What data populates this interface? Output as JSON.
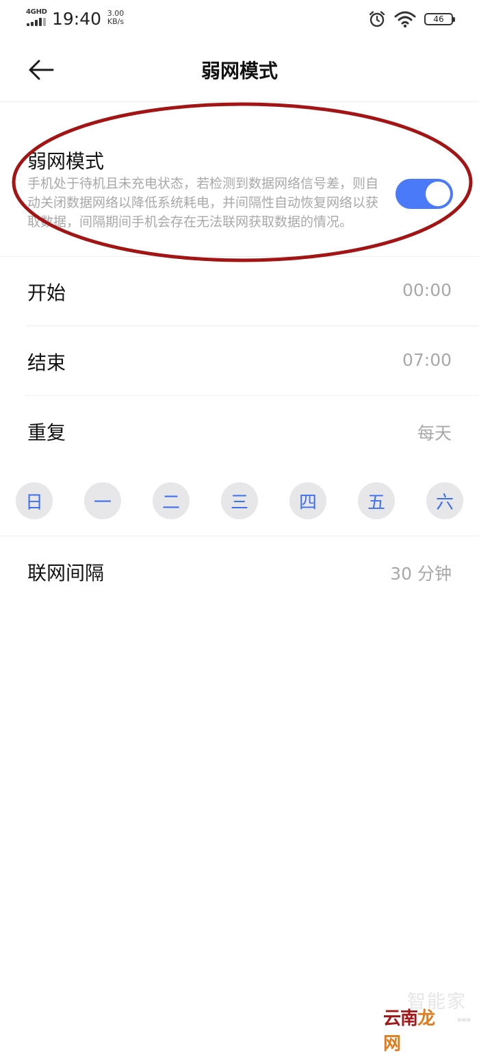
{
  "status_bar": {
    "network": "4GHD",
    "time": "19:40",
    "speed_value": "3.00",
    "speed_unit": "KB/s",
    "battery": "46"
  },
  "header": {
    "title": "弱网模式"
  },
  "weak_mode": {
    "title": "弱网模式",
    "description": "手机处于待机且未充电状态，若检测到数据网络信号差，则自动关闭数据网络以降低系统耗电，并间隔性自动恢复网络以获取数据，间隔期间手机会存在无法联网获取数据的情况。",
    "enabled": true
  },
  "start": {
    "label": "开始",
    "value": "00:00"
  },
  "end": {
    "label": "结束",
    "value": "07:00"
  },
  "repeat": {
    "label": "重复",
    "value": "每天"
  },
  "weekdays": [
    "日",
    "一",
    "二",
    "三",
    "四",
    "五",
    "六"
  ],
  "interval": {
    "label": "联网间隔",
    "value": "30 分钟"
  },
  "watermark": {
    "ghost": "智能家",
    "site_a": "云南",
    "site_b": "龙网",
    "small": "www"
  },
  "colors": {
    "accent": "#4a7af7",
    "weekday_text": "#3d6ff0",
    "weekday_bg": "#e7e7e9",
    "highlight": "#a31414"
  }
}
